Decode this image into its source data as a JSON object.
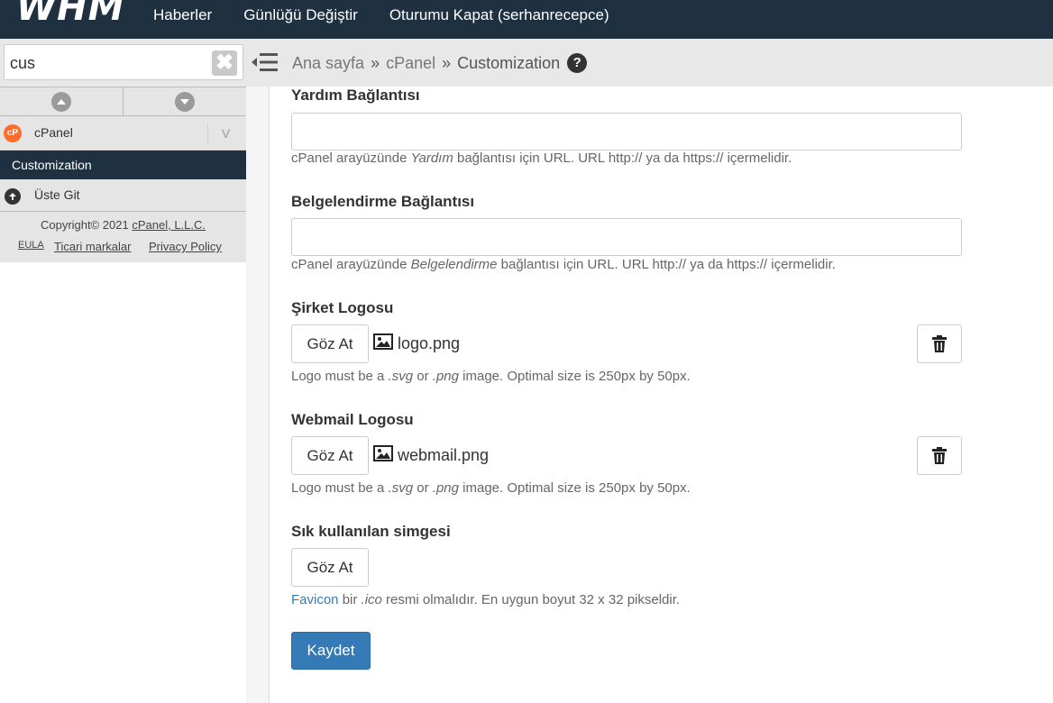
{
  "header": {
    "logo": "WHM",
    "nav": [
      "Haberler",
      "Günlüğü Değiştir",
      "Oturumu Kapat (serhanrecepce)"
    ]
  },
  "sidebar": {
    "search_value": "cus",
    "section_label": "cPanel",
    "section_toggle": "V",
    "active_item": "Customization",
    "back_label": "Üste Git",
    "copyright_prefix": "Copyright© 2021 ",
    "copyright_link": "cPanel, L.L.C.",
    "links": [
      "EULA",
      "Ticari markalar",
      "Privacy Policy"
    ]
  },
  "breadcrumb": {
    "items": [
      "Ana sayfa",
      "cPanel",
      "Customization"
    ],
    "separator": "»",
    "help": "?"
  },
  "form": {
    "help_link": {
      "label": "Yardım Bağlantısı",
      "value": "",
      "hint_prefix": "cPanel arayüzünde ",
      "hint_em": "Yardım",
      "hint_suffix": " bağlantısı için URL. URL http:// ya da https:// içermelidir."
    },
    "doc_link": {
      "label": "Belgelendirme Bağlantısı",
      "value": "",
      "hint_prefix": "cPanel arayüzünde ",
      "hint_em": "Belgelendirme",
      "hint_suffix": " bağlantısı için URL. URL http:// ya da https:// içermelidir."
    },
    "company_logo": {
      "label": "Şirket Logosu",
      "browse": "Göz At",
      "file": "logo.png",
      "hint_prefix": "Logo must be a ",
      "hint_em1": ".svg",
      "hint_mid": " or ",
      "hint_em2": ".png",
      "hint_suffix": " image. Optimal size is 250px by 50px."
    },
    "webmail_logo": {
      "label": "Webmail Logosu",
      "browse": "Göz At",
      "file": "webmail.png",
      "hint_prefix": "Logo must be a ",
      "hint_em1": ".svg",
      "hint_mid": " or ",
      "hint_em2": ".png",
      "hint_suffix": " image. Optimal size is 250px by 50px."
    },
    "favicon": {
      "label": "Sık kullanılan simgesi",
      "browse": "Göz At",
      "hint_link": "Favicon",
      "hint_prefix": " bir ",
      "hint_em": ".ico",
      "hint_suffix": " resmi olmalıdır. En uygun boyut 32 x 32 pikseldir."
    },
    "save": "Kaydet"
  },
  "icons": {
    "search_clear": "close-icon",
    "nav_up": "chevron-up-icon",
    "nav_down": "chevron-down-icon",
    "cpanel": "cpanel-icon",
    "back": "arrow-up-icon",
    "menu": "hamburger-icon",
    "help": "help-icon",
    "file": "image-icon",
    "trash": "trash-icon"
  },
  "colors": {
    "topbar": "#1f3141",
    "primary": "#337ab7",
    "cpanel_orange": "#ff6c2c"
  }
}
